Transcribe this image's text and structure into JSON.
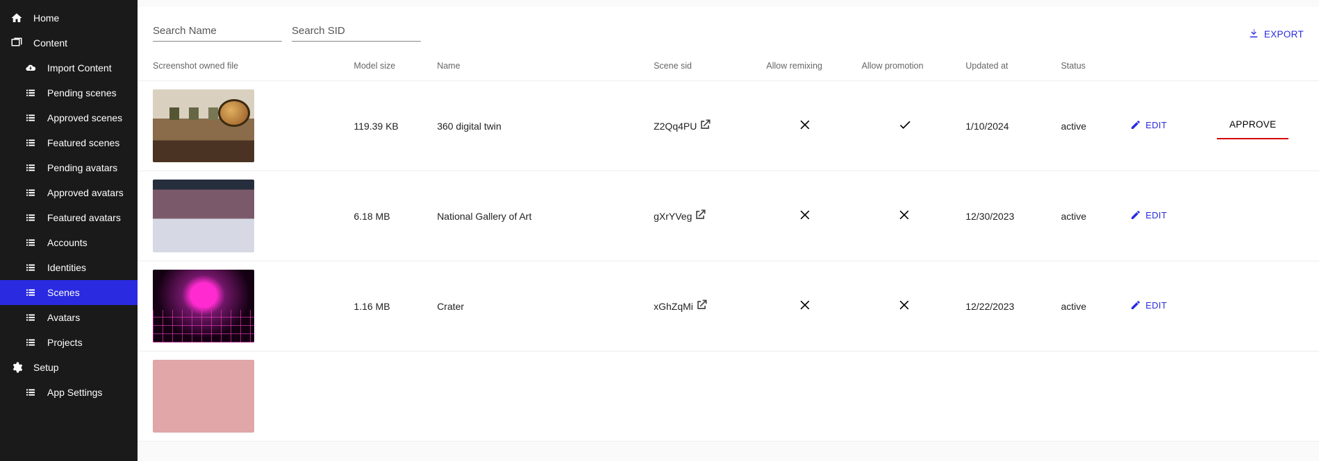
{
  "sidebar": {
    "home": "Home",
    "content": "Content",
    "import": "Import Content",
    "pending_scenes": "Pending scenes",
    "approved_scenes": "Approved scenes",
    "featured_scenes": "Featured scenes",
    "pending_avatars": "Pending avatars",
    "approved_avatars": "Approved avatars",
    "featured_avatars": "Featured avatars",
    "accounts": "Accounts",
    "identities": "Identities",
    "scenes": "Scenes",
    "avatars": "Avatars",
    "projects": "Projects",
    "setup": "Setup",
    "app_settings": "App Settings"
  },
  "toolbar": {
    "search_name_ph": "Search Name",
    "search_sid_ph": "Search SID",
    "export": "EXPORT"
  },
  "headers": {
    "screenshot": "Screenshot owned file",
    "model_size": "Model size",
    "name": "Name",
    "scene_sid": "Scene sid",
    "allow_remixing": "Allow remixing",
    "allow_promotion": "Allow promotion",
    "updated_at": "Updated at",
    "status": "Status"
  },
  "actions": {
    "edit": "EDIT",
    "approve": "APPROVE"
  },
  "rows": [
    {
      "thumb": "gallery",
      "size": "119.39 KB",
      "name": "360 digital twin",
      "sid": "Z2Qq4PU",
      "remix": false,
      "promo": true,
      "updated": "1/10/2024",
      "status": "active",
      "approve": true
    },
    {
      "thumb": "plaza",
      "size": "6.18 MB",
      "name": "National Gallery of Art",
      "sid": "gXrYVeg",
      "remix": false,
      "promo": false,
      "updated": "12/30/2023",
      "status": "active",
      "approve": false
    },
    {
      "thumb": "grid",
      "size": "1.16 MB",
      "name": "Crater",
      "sid": "xGhZqMi",
      "remix": false,
      "promo": false,
      "updated": "12/22/2023",
      "status": "active",
      "approve": false
    },
    {
      "thumb": "pink",
      "size": "",
      "name": "",
      "sid": "",
      "remix": false,
      "promo": false,
      "updated": "",
      "status": "",
      "approve": false
    }
  ]
}
